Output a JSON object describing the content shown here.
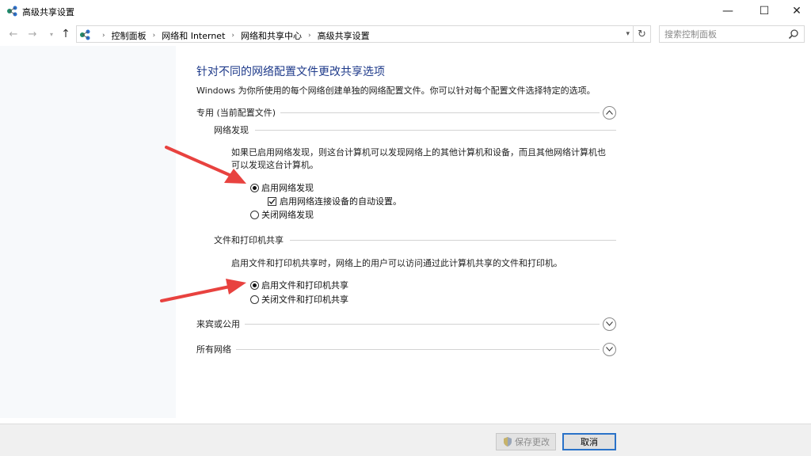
{
  "window": {
    "title": "高级共享设置",
    "minimize_glyph": "—",
    "maximize_glyph": "☐",
    "close_glyph": "✕"
  },
  "nav": {
    "back_glyph": "←",
    "forward_glyph": "→",
    "dropdown_glyph": "▾",
    "up_glyph": "↑",
    "breadcrumbs": [
      "控制面板",
      "网络和 Internet",
      "网络和共享中心",
      "高级共享设置"
    ],
    "separator_glyph": "›",
    "refresh_glyph": "↻",
    "search_placeholder": "搜索控制面板"
  },
  "content": {
    "title": "针对不同的网络配置文件更改共享选项",
    "description": "Windows 为你所使用的每个网络创建单独的网络配置文件。你可以针对每个配置文件选择特定的选项。",
    "private_section": {
      "label": "专用 (当前配置文件)",
      "network_discovery": {
        "heading": "网络发现",
        "description_line1": "如果已启用网络发现，则这台计算机可以发现网络上的其他计算机和设备，而且其他网络计算机也",
        "description_line2": "可以发现这台计算机。",
        "options": [
          "启用网络发现",
          "关闭网络发现"
        ],
        "auto_setup_label": "启用网络连接设备的自动设置。"
      },
      "file_printer_sharing": {
        "heading": "文件和打印机共享",
        "description": "启用文件和打印机共享时，网络上的用户可以访问通过此计算机共享的文件和打印机。",
        "options": [
          "启用文件和打印机共享",
          "关闭文件和打印机共享"
        ]
      }
    },
    "guest_section": {
      "label": "来宾或公用"
    },
    "all_networks_section": {
      "label": "所有网络"
    }
  },
  "footer": {
    "save_label": "保存更改",
    "cancel_label": "取消"
  },
  "colors": {
    "title_blue": "#1e3a8a",
    "annotation_red": "#e8423f",
    "button_focus": "#2a72c8"
  }
}
